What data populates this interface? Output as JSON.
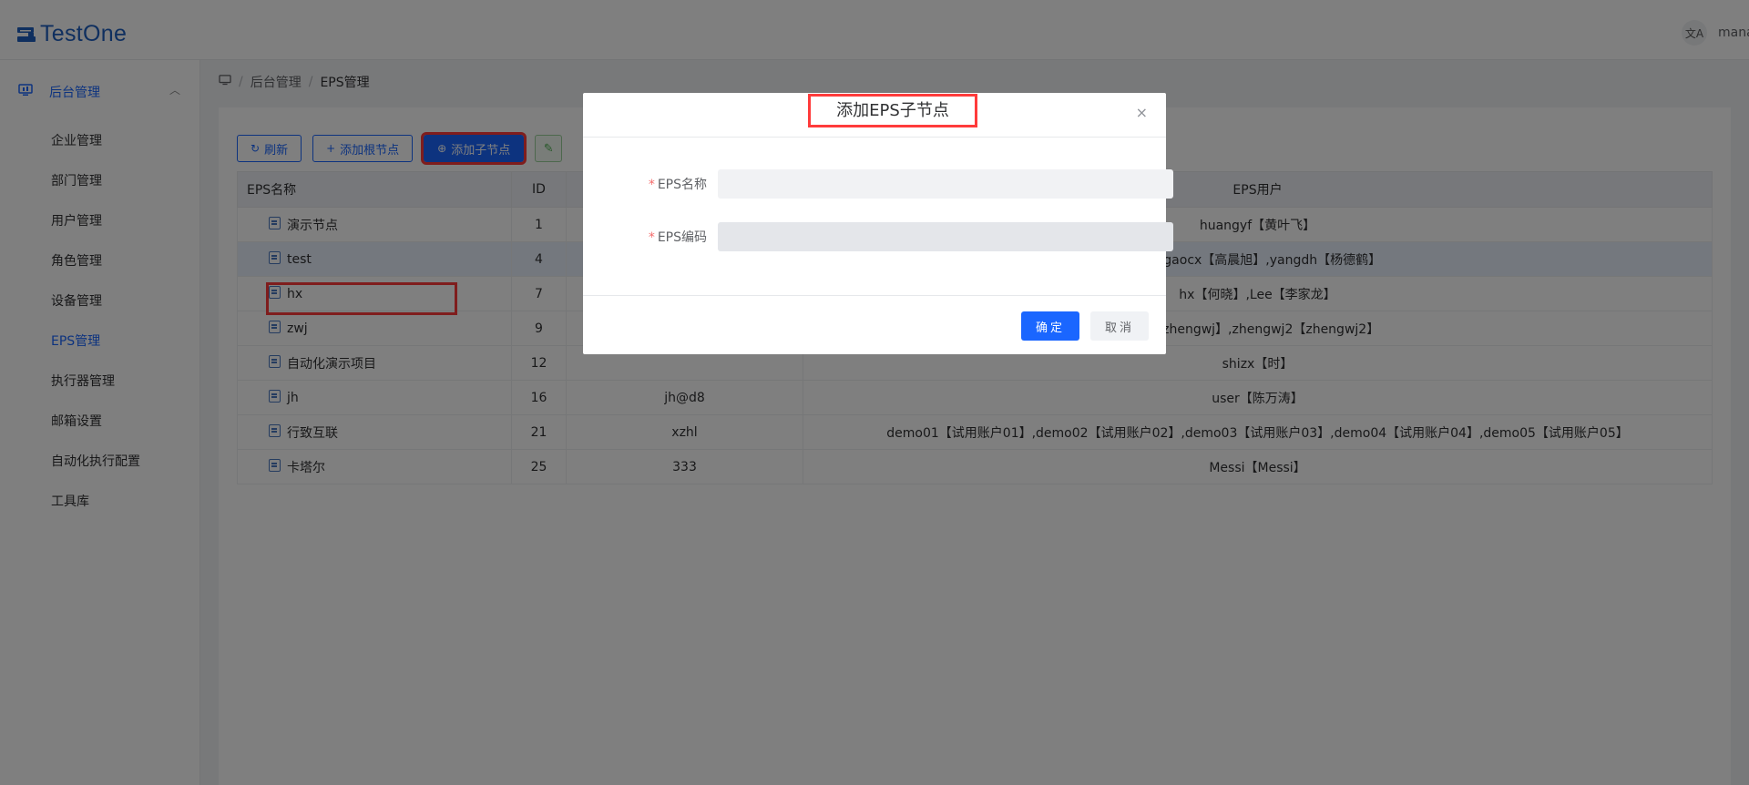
{
  "app": {
    "logo_text": "TestOne",
    "user_name": "mana",
    "lang_icon": "文A"
  },
  "sidebar": {
    "parent": {
      "label": "后台管理",
      "icon": "monitor-icon"
    },
    "items": [
      {
        "label": "企业管理",
        "active": false
      },
      {
        "label": "部门管理",
        "active": false
      },
      {
        "label": "用户管理",
        "active": false
      },
      {
        "label": "角色管理",
        "active": false
      },
      {
        "label": "设备管理",
        "active": false
      },
      {
        "label": "EPS管理",
        "active": true
      },
      {
        "label": "执行器管理",
        "active": false
      },
      {
        "label": "邮箱设置",
        "active": false
      },
      {
        "label": "自动化执行配置",
        "active": false
      },
      {
        "label": "工具库",
        "active": false
      }
    ]
  },
  "breadcrumb": {
    "home_icon": "monitor-icon",
    "level1": "后台管理",
    "level2": "EPS管理",
    "sep": "/"
  },
  "toolbar": {
    "refresh": "刷新",
    "add_root": "添加根节点",
    "add_child": "添加子节点"
  },
  "table": {
    "headers": {
      "name": "EPS名称",
      "id": "ID",
      "code": "",
      "users": "EPS用户"
    },
    "rows": [
      {
        "name": "演示节点",
        "id": "1",
        "code": "",
        "users": "huangyf【黄叶飞】"
      },
      {
        "name": "test",
        "id": "4",
        "code": "",
        "users": "龙】,gaocx【高晨旭】,yangdh【杨德鹤】"
      },
      {
        "name": "hx",
        "id": "7",
        "code": "",
        "users": "hx【何晓】,Lee【李家龙】"
      },
      {
        "name": "zwj",
        "id": "9",
        "code": "",
        "users": "wj【zhengwj】,zhengwj2【zhengwj2】"
      },
      {
        "name": "自动化演示项目",
        "id": "12",
        "code": "",
        "users": "shizx【时】"
      },
      {
        "name": "jh",
        "id": "16",
        "code": "jh@d8",
        "users": "user【陈万涛】"
      },
      {
        "name": "行致互联",
        "id": "21",
        "code": "xzhl",
        "users": "demo01【试用账户01】,demo02【试用账户02】,demo03【试用账户03】,demo04【试用账户04】,demo05【试用账户05】"
      },
      {
        "name": "卡塔尔",
        "id": "25",
        "code": "333",
        "users": "Messi【Messi】"
      }
    ]
  },
  "modal": {
    "title": "添加EPS子节点",
    "close": "×",
    "fields": [
      {
        "label": "EPS名称",
        "value": "",
        "placeholder": ""
      },
      {
        "label": "EPS编码",
        "value": "",
        "placeholder": ""
      }
    ],
    "ok": "确定",
    "cancel": "取消"
  },
  "colors": {
    "accent": "#1a66ff",
    "highlight": "#ff3b3b",
    "required": "#f56c6c"
  }
}
